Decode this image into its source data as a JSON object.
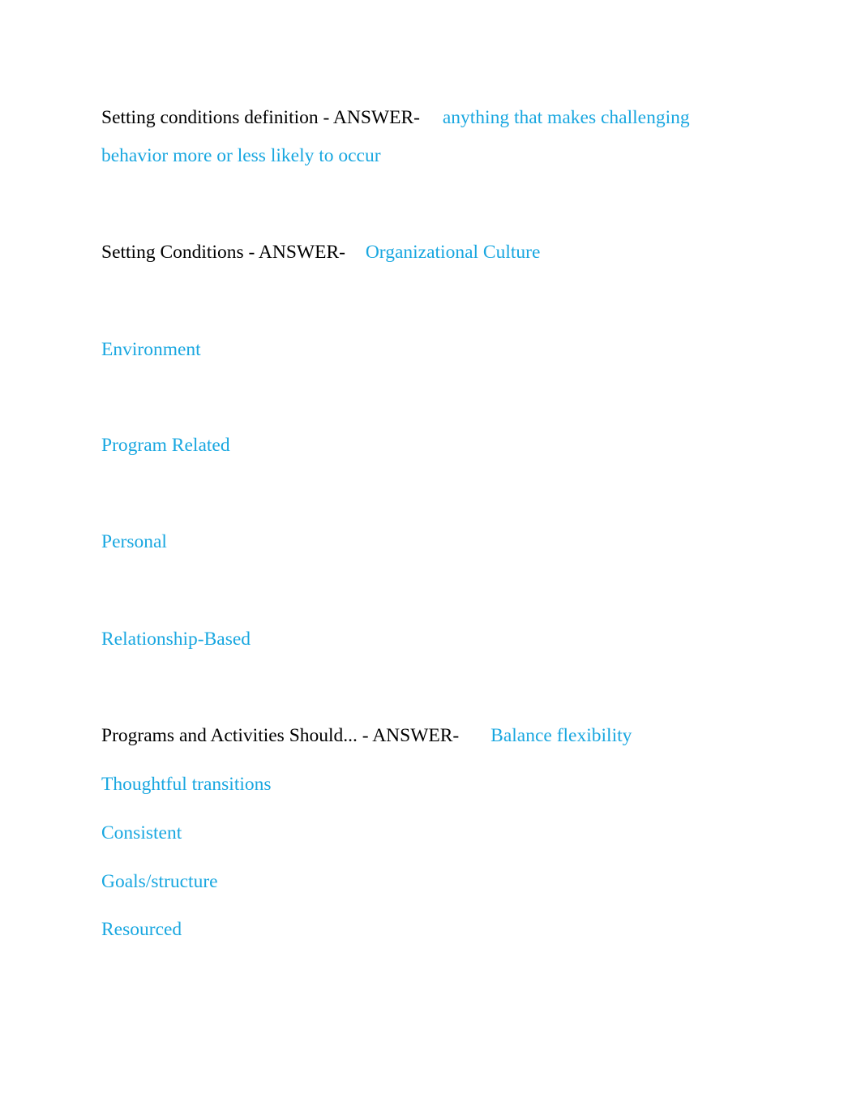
{
  "colors": {
    "question": "#000000",
    "answer": "#19a7e0"
  },
  "cards": [
    {
      "question": "Setting conditions definition - ANSWER-",
      "answer_lines": [
        "anything that makes challenging",
        "behavior more or less likely to occur"
      ]
    },
    {
      "question": "Setting Conditions - ANSWER-",
      "answer_lines": [
        "Organizational Culture",
        "Environment",
        "Program Related",
        "Personal",
        "Relationship-Based"
      ]
    },
    {
      "question": "Programs and Activities Should... - ANSWER-",
      "answer_lines": [
        "Balance flexibility",
        "Thoughtful transitions",
        "Consistent",
        "Goals/structure",
        "Resourced"
      ]
    }
  ]
}
